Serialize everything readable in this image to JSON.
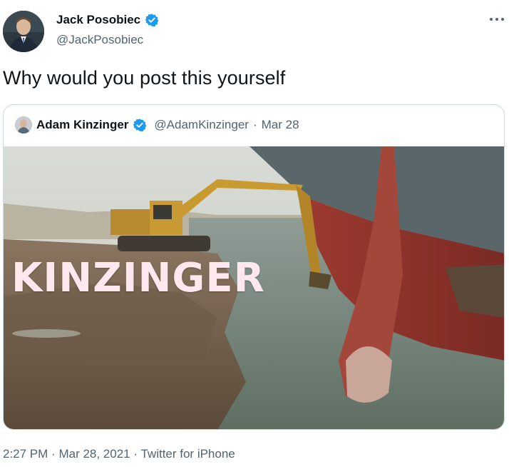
{
  "author": {
    "display_name": "Jack Posobiec",
    "handle": "@JackPosobiec",
    "verified": true,
    "avatar_icon": "profile-photo-man-in-suit"
  },
  "tweet": {
    "text": "Why would you post this yourself"
  },
  "quoted_tweet": {
    "display_name": "Adam Kinzinger",
    "handle": "@AdamKinzinger",
    "separator": "·",
    "date": "Mar 28",
    "verified": true,
    "media": {
      "overlay_text": "KINZINGER",
      "subject": "excavator digging beside a stranded ship bow"
    }
  },
  "meta": {
    "time": "2:27 PM",
    "separator1": "·",
    "date": "Mar 28, 2021",
    "separator2": "·",
    "source": "Twitter for iPhone"
  },
  "icons": {
    "more": "more-horizontal-icon",
    "verified": "verified-badge-icon"
  },
  "colors": {
    "verified_blue": "#1d9bf0",
    "secondary_text": "#536471",
    "border": "#cfd9de"
  }
}
